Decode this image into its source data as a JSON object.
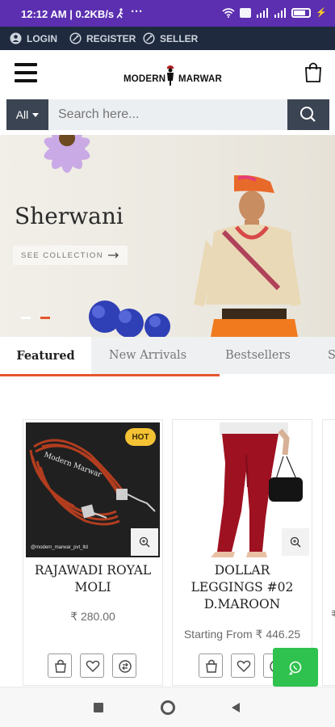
{
  "status_bar": {
    "time": "12:12 AM | 0.2KB/s",
    "battery": "83"
  },
  "account_bar": {
    "login": "LOGIN",
    "register": "REGISTER",
    "seller": "SELLER"
  },
  "header": {
    "logo_left": "MODERN",
    "logo_right": "MARWAR"
  },
  "search": {
    "category": "All",
    "placeholder": "Search here..."
  },
  "banner": {
    "title": "Sherwani",
    "cta": "SEE COLLECTION"
  },
  "tabs": [
    "Featured",
    "New Arrivals",
    "Bestsellers",
    "S"
  ],
  "products": [
    {
      "name_line1": "RAJAWADI ROYAL",
      "name_line2": "MOLI",
      "price": "₹ 280.00",
      "badge": "HOT",
      "watermark": "@modern_marwar_pvt_ltd"
    },
    {
      "name_line1": "DOLLAR",
      "name_line2": "LEGGINGS #02",
      "name_line3": "D.MAROON",
      "price": "Starting From ₹ 446.25"
    }
  ],
  "third_card_partial_price": "₹",
  "colors": {
    "status_bar": "#5b2fb0",
    "account_bar": "#1f2a3f",
    "accent": "#e4572e",
    "whatsapp": "#2fc24e",
    "hot_badge": "#f4c235"
  },
  "icons": [
    "user-icon",
    "register-icon",
    "seller-icon",
    "menu-icon",
    "shopping-bag-icon",
    "search-icon",
    "zoom-icon",
    "bag-icon",
    "heart-icon",
    "compare-icon",
    "whatsapp-icon",
    "recent-apps-icon",
    "home-icon",
    "back-icon"
  ]
}
